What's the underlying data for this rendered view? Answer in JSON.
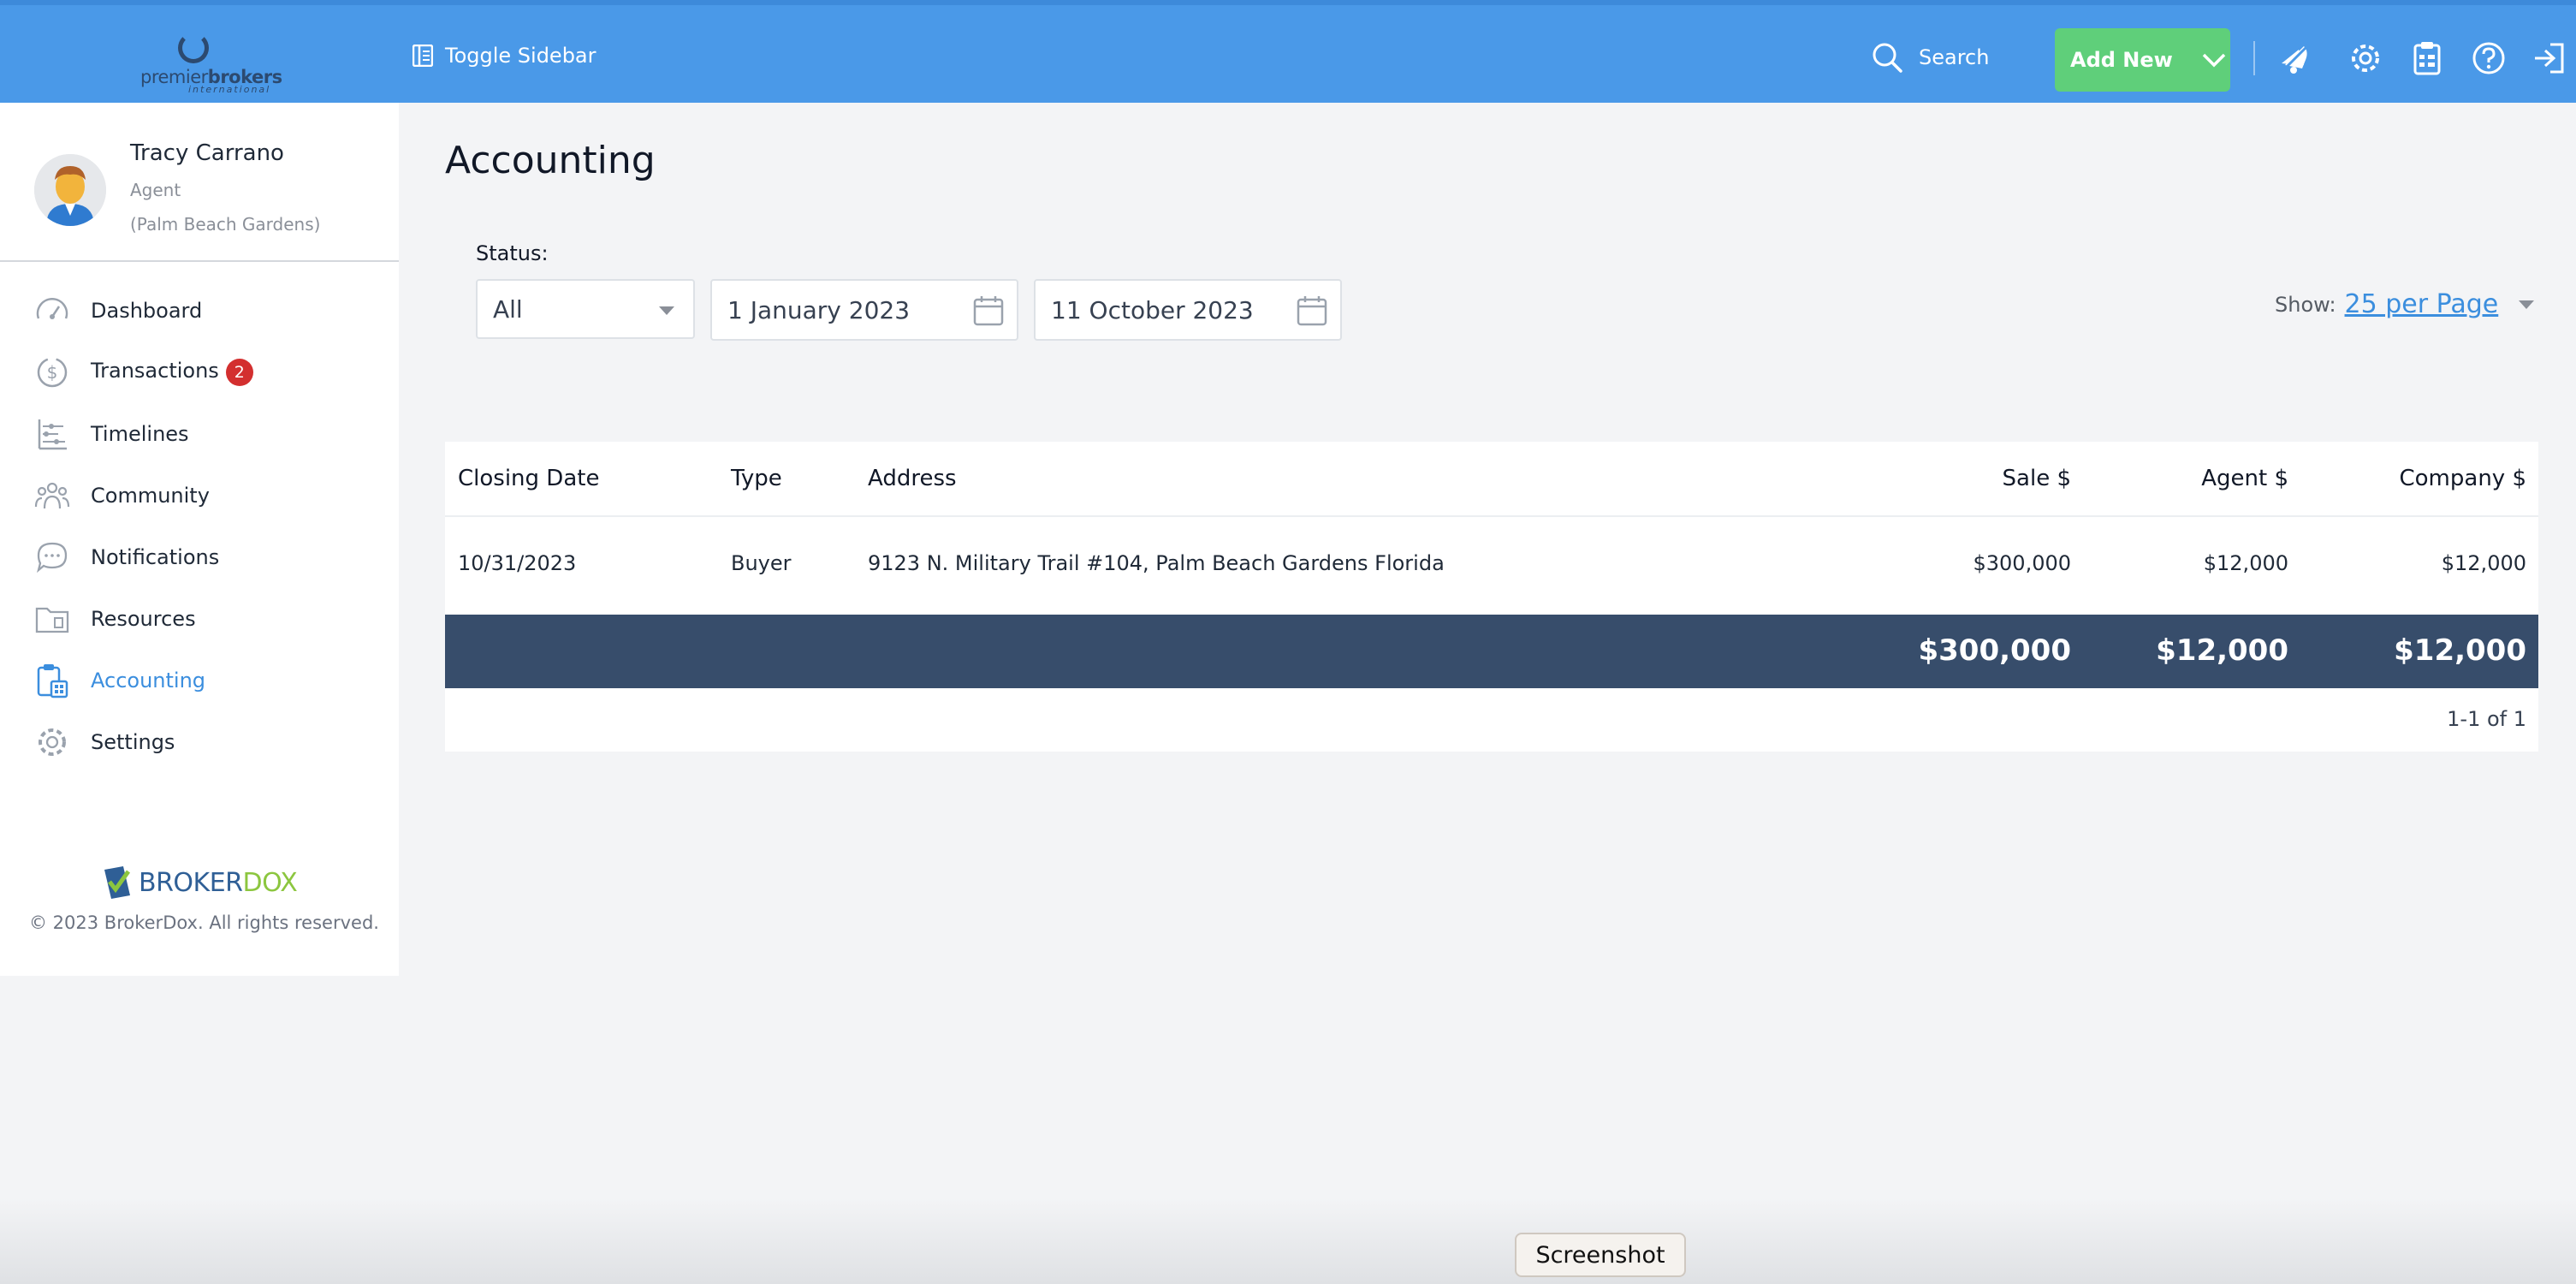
{
  "topbar": {
    "logo": {
      "text_light": "premier",
      "text_bold": "brokers",
      "sub": "international"
    },
    "toggle_label": "Toggle Sidebar",
    "search_label": "Search",
    "add_new_label": "Add New",
    "icons": [
      "bell-slash-icon",
      "gear-icon",
      "clipboard-icon",
      "help-icon",
      "logout-icon"
    ],
    "accent_color": "#4a99e8",
    "add_new_color": "#5fcf7a"
  },
  "profile": {
    "name": "Tracy Carrano",
    "role": "Agent",
    "location": "(Palm Beach Gardens)"
  },
  "sidebar": {
    "items": [
      {
        "label": "Dashboard",
        "icon": "gauge-icon"
      },
      {
        "label": "Transactions",
        "icon": "dollar-circle-icon",
        "badge": "2"
      },
      {
        "label": "Timelines",
        "icon": "timeline-icon"
      },
      {
        "label": "Community",
        "icon": "people-icon"
      },
      {
        "label": "Notifications",
        "icon": "chat-bubble-icon"
      },
      {
        "label": "Resources",
        "icon": "folder-icon"
      },
      {
        "label": "Accounting",
        "icon": "calculator-icon",
        "active": true
      },
      {
        "label": "Settings",
        "icon": "gear-icon"
      }
    ],
    "brand": {
      "part1": "BROKER",
      "part2": "DOX"
    },
    "copyright": "© 2023 BrokerDox. All rights reserved."
  },
  "main": {
    "title": "Accounting",
    "status_label": "Status:",
    "status_value": "All",
    "date_from": "1 January 2023",
    "date_to": "11 October 2023",
    "show_label": "Show:",
    "show_value": "25 per Page"
  },
  "table": {
    "headers": [
      "Closing Date",
      "Type",
      "Address",
      "Sale $",
      "Agent $",
      "Company $"
    ],
    "rows": [
      [
        "10/31/2023",
        "Buyer",
        "9123 N. Military Trail #104, Palm Beach Gardens Florida",
        "$300,000",
        "$12,000",
        "$12,000"
      ]
    ],
    "totals": {
      "sale": "$300,000",
      "agent": "$12,000",
      "company": "$12,000"
    },
    "pager": "1-1 of 1",
    "totals_bar_color": "#374d6b"
  },
  "tooltip": {
    "label": "Screenshot"
  }
}
